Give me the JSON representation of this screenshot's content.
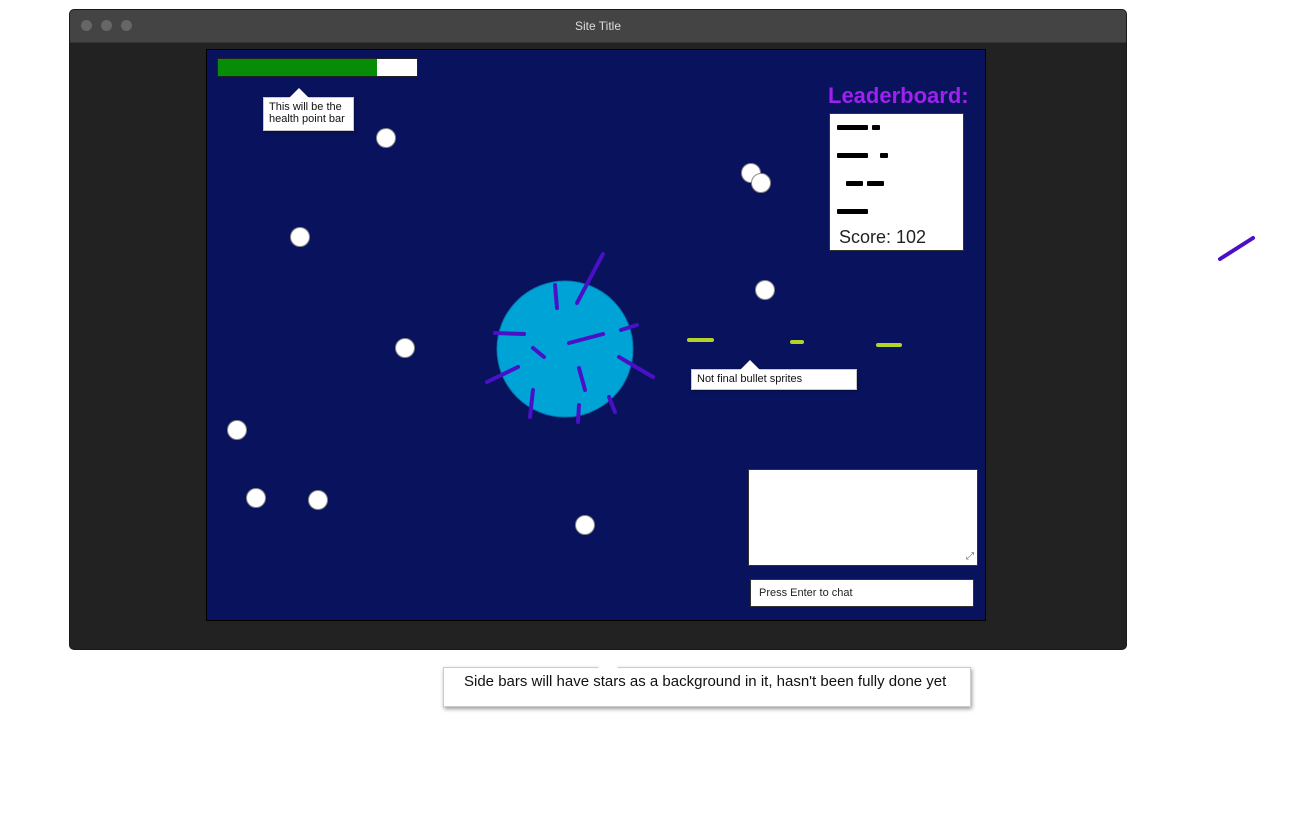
{
  "window": {
    "title": "Site Title"
  },
  "hud": {
    "health_fraction": 0.8
  },
  "annotations": {
    "health_note": "This will be the health point bar",
    "bullet_note": "Not final bullet sprites",
    "sidebar_note": "Side bars will have stars as a background in it, hasn't been fully done yet"
  },
  "leaderboard": {
    "title": "Leaderboard:",
    "score_text": "Score: 102"
  },
  "chat": {
    "input_placeholder": "Press Enter to chat"
  },
  "colors": {
    "game_bg": "#09125c",
    "health_fill": "#078c07",
    "player_body": "#00a3d6",
    "player_spikes": "#4a10c8",
    "bullet": "#b4d22a",
    "leaderboard_title": "#a020f0"
  },
  "icons": {
    "window_controls": [
      "close-dot",
      "minimize-dot",
      "maximize-dot"
    ]
  }
}
